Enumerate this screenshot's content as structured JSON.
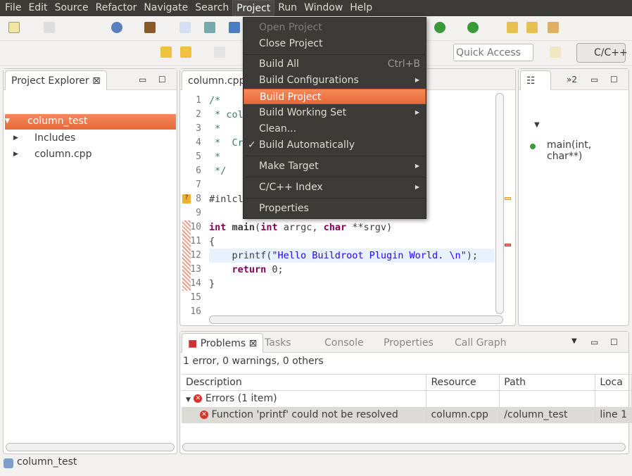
{
  "menubar": [
    "File",
    "Edit",
    "Source",
    "Refactor",
    "Navigate",
    "Search",
    "Project",
    "Run",
    "Window",
    "Help"
  ],
  "active_menu": "Project",
  "toolbar": {
    "quick_access_placeholder": "Quick Access",
    "perspective": "C/C++"
  },
  "project_menu": {
    "items": [
      {
        "label": "Open Project",
        "disabled": true
      },
      {
        "label": "Close Project"
      },
      {
        "label": "Build All",
        "shortcut": "Ctrl+B"
      },
      {
        "label": "Build Configurations",
        "submenu": true
      },
      {
        "label": "Build Project",
        "highlighted": true
      },
      {
        "label": "Build Working Set",
        "submenu": true
      },
      {
        "label": "Clean..."
      },
      {
        "label": "Build Automatically",
        "checked": true
      },
      {
        "label": "Make Target",
        "submenu": true
      },
      {
        "label": "C/C++ Index",
        "submenu": true
      },
      {
        "label": "Properties"
      }
    ]
  },
  "explorer": {
    "title": "Project Explorer",
    "tree": [
      {
        "label": "column_test",
        "selected": true
      },
      {
        "label": "Includes"
      },
      {
        "label": "column.cpp"
      }
    ]
  },
  "editor": {
    "tab": "column.cpp",
    "line_numbers": [
      "1",
      "2",
      "3",
      "4",
      "5",
      "6",
      "7",
      "8",
      "9",
      "10",
      "11",
      "12",
      "13",
      "14",
      "15",
      "16"
    ],
    "lines": [
      "/*",
      " * col",
      " *",
      " *  Cr",
      " *",
      " */",
      "",
      "#inlcl",
      "",
      "int main(int arrgc, char **srgv)",
      "{",
      "    printf(\"Hello Buildroot Plugin World. \\n\");",
      "    return 0;",
      "}",
      "",
      ""
    ]
  },
  "outline": {
    "overflow": "»2",
    "item": "main(int, char**)"
  },
  "problems": {
    "tabs": [
      "Problems",
      "Tasks",
      "Console",
      "Properties",
      "Call Graph"
    ],
    "summary": "1 error, 0 warnings, 0 others",
    "columns": [
      "Description",
      "Resource",
      "Path",
      "Loca"
    ],
    "group": "Errors (1 item)",
    "rows": [
      {
        "description": "Function 'printf' could not be resolved",
        "resource": "column.cpp",
        "path": "/column_test",
        "location": "line 1"
      }
    ]
  },
  "status": {
    "text": "column_test"
  },
  "colors": {
    "accent": "#f07746",
    "menu_bg": "#3c3b37"
  }
}
